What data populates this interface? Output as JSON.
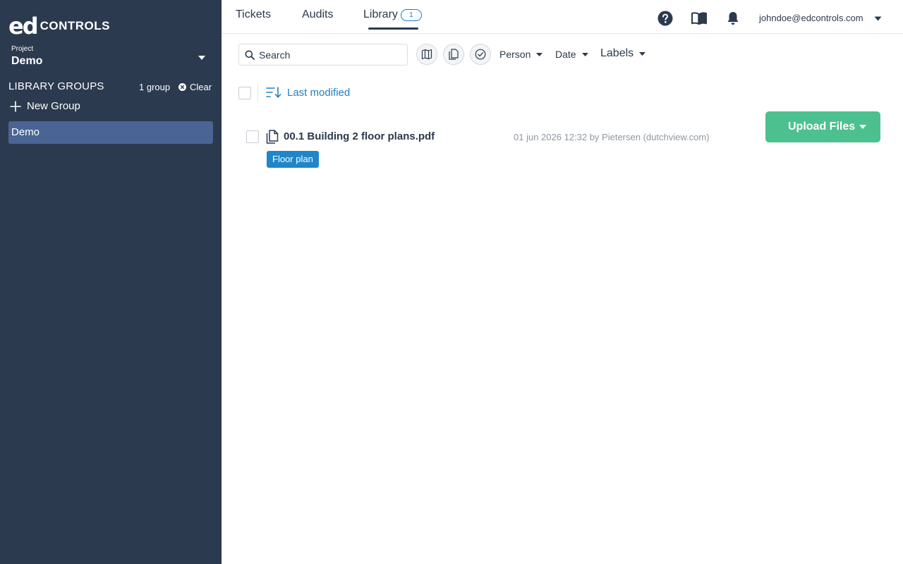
{
  "sidebar": {
    "logo_ed": "ed",
    "logo_controls": "CONTROLS",
    "project_label": "Project",
    "project_value": "Demo",
    "library_groups_title": "LIBRARY GROUPS",
    "group_count": "1 group",
    "clear_label": "Clear",
    "new_group_label": "New Group",
    "groups": [
      {
        "label": "Demo",
        "selected": true
      }
    ]
  },
  "topnav": {
    "tabs": [
      {
        "label": "Tickets"
      },
      {
        "label": "Audits"
      },
      {
        "label": "Library",
        "badge": "1",
        "active": true
      }
    ],
    "icons": [
      "help-icon",
      "book-icon",
      "bell-icon"
    ],
    "user_email": "johndoe@edcontrols.com"
  },
  "filters": {
    "search_placeholder": "Search",
    "icon_buttons": [
      "map-icon",
      "document-icon",
      "check-circle-icon"
    ],
    "person_label": "Person",
    "date_label": "Date",
    "labels_label": "Labels"
  },
  "list": {
    "sort_label": "Last modified",
    "files": [
      {
        "name": "00.1 Building 2 floor plans.pdf",
        "meta": "01 jun 2026 12:32 by Pietersen (dutchview.com)",
        "tag": "Floor plan"
      }
    ]
  },
  "upload": {
    "label": "Upload Files"
  },
  "colors": {
    "sidebar_bg": "#2c3a4f",
    "selected_group_bg": "#4a6593",
    "accent_blue": "#2180c0",
    "upload_green": "#4cc18f",
    "tag_blue": "#1f87c9"
  }
}
